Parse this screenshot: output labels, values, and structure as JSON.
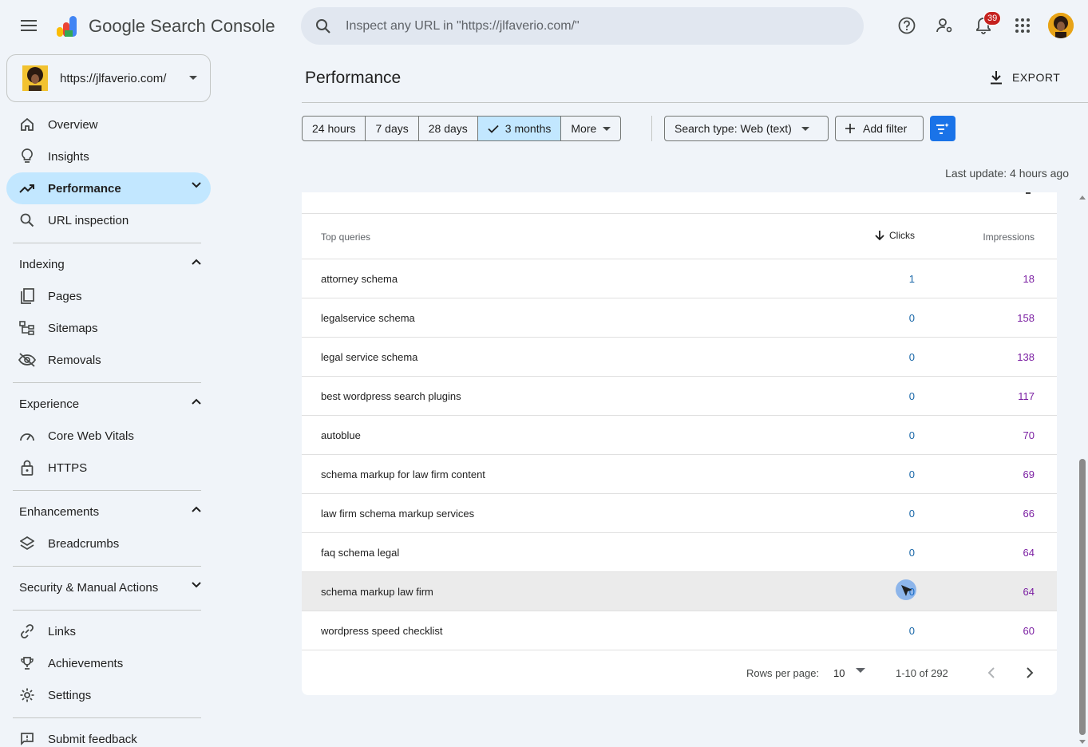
{
  "app": {
    "title_google": "Google",
    "title_product": "Search Console"
  },
  "search": {
    "placeholder": "Inspect any URL in \"https://jlfaverio.com/\""
  },
  "notifications": {
    "count": "39"
  },
  "property": {
    "url": "https://jlfaverio.com/"
  },
  "sidebar": {
    "items": [
      {
        "label": "Overview",
        "icon": "home-icon"
      },
      {
        "label": "Insights",
        "icon": "lightbulb-icon"
      },
      {
        "label": "Performance",
        "icon": "trending-up-icon",
        "active": true
      },
      {
        "label": "URL inspection",
        "icon": "search-icon"
      }
    ],
    "sections": {
      "indexing": {
        "title": "Indexing",
        "items": [
          {
            "label": "Pages",
            "icon": "pages-icon"
          },
          {
            "label": "Sitemaps",
            "icon": "sitemap-icon"
          },
          {
            "label": "Removals",
            "icon": "visibility-off-icon"
          }
        ]
      },
      "experience": {
        "title": "Experience",
        "items": [
          {
            "label": "Core Web Vitals",
            "icon": "speed-icon"
          },
          {
            "label": "HTTPS",
            "icon": "lock-icon"
          }
        ]
      },
      "enhancements": {
        "title": "Enhancements",
        "items": [
          {
            "label": "Breadcrumbs",
            "icon": "layers-icon"
          }
        ]
      },
      "security": {
        "title": "Security & Manual Actions"
      }
    },
    "bottom": [
      {
        "label": "Links",
        "icon": "link-icon"
      },
      {
        "label": "Achievements",
        "icon": "trophy-icon"
      },
      {
        "label": "Settings",
        "icon": "gear-icon"
      },
      {
        "label": "Submit feedback",
        "icon": "feedback-icon"
      }
    ]
  },
  "main": {
    "title": "Performance",
    "export_label": "EXPORT",
    "date_ranges": [
      "24 hours",
      "7 days",
      "28 days",
      "3 months",
      "More"
    ],
    "selected_range": "3 months",
    "search_type": "Search type: Web (text)",
    "add_filter": "Add filter",
    "last_update": "Last update: 4 hours ago"
  },
  "table": {
    "headers": {
      "query": "Top queries",
      "clicks": "Clicks",
      "impressions": "Impressions"
    },
    "rows": [
      {
        "query": "attorney schema",
        "clicks": "1",
        "impressions": "18"
      },
      {
        "query": "legalservice schema",
        "clicks": "0",
        "impressions": "158"
      },
      {
        "query": "legal service schema",
        "clicks": "0",
        "impressions": "138"
      },
      {
        "query": "best wordpress search plugins",
        "clicks": "0",
        "impressions": "117"
      },
      {
        "query": "autoblue",
        "clicks": "0",
        "impressions": "70"
      },
      {
        "query": "schema markup for law firm content",
        "clicks": "0",
        "impressions": "69"
      },
      {
        "query": "law firm schema markup services",
        "clicks": "0",
        "impressions": "66"
      },
      {
        "query": "faq schema legal",
        "clicks": "0",
        "impressions": "64"
      },
      {
        "query": "schema markup law firm",
        "clicks": "0",
        "impressions": "64"
      },
      {
        "query": "wordpress speed checklist",
        "clicks": "0",
        "impressions": "60"
      }
    ],
    "pager": {
      "rows_label": "Rows per page:",
      "rows_value": "10",
      "range": "1-10 of 292"
    }
  },
  "colors": {
    "accent": "#1a73e8",
    "active_nav": "#c2e7ff",
    "clicks": "#1967a8",
    "impressions": "#7b1fa2"
  }
}
